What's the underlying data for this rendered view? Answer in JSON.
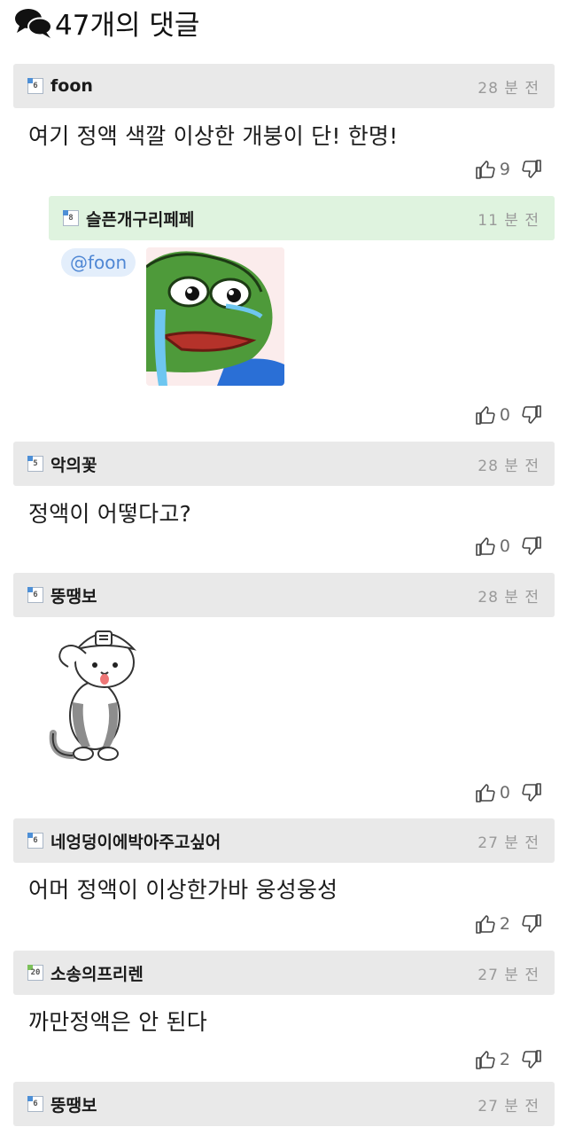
{
  "header": {
    "title": "47개의 댓글",
    "icon": "speech-bubbles-icon"
  },
  "comments": [
    {
      "nick": "foon",
      "level": "6",
      "time": "28 분 전",
      "text": "여기 정액 색깔 이상한 개붕이 단! 한명!",
      "likes": "9"
    },
    {
      "nick": "슬픈개구리페페",
      "level": "8",
      "time": "11 분 전",
      "mention": "@foon",
      "sticker": "crying-frog-sticker",
      "likes": "0",
      "reply": true
    },
    {
      "nick": "악의꽃",
      "level": "5",
      "time": "28 분 전",
      "text": "정액이 어떻다고?",
      "likes": "0"
    },
    {
      "nick": "뚱땡보",
      "level": "6",
      "time": "28 분 전",
      "sticker": "saluting-cat-sticker",
      "likes": "0"
    },
    {
      "nick": "네엉덩이에박아주고싶어",
      "level": "6",
      "time": "27 분 전",
      "text": "어머 정액이 이상한가바 웅성웅성",
      "likes": "2"
    },
    {
      "nick": "소송의프리렌",
      "level": "20",
      "time": "27 분 전",
      "text": "까만정액은 안 된다",
      "likes": "2"
    },
    {
      "nick": "뚱땡보",
      "level": "6",
      "time": "27 분 전"
    }
  ],
  "colors": {
    "header_bg": "#e9e9e9",
    "reply_bg": "#dff3df",
    "mention_bg": "#e3eefb",
    "mention_text": "#4f87d4",
    "time": "#9a9a9a"
  }
}
